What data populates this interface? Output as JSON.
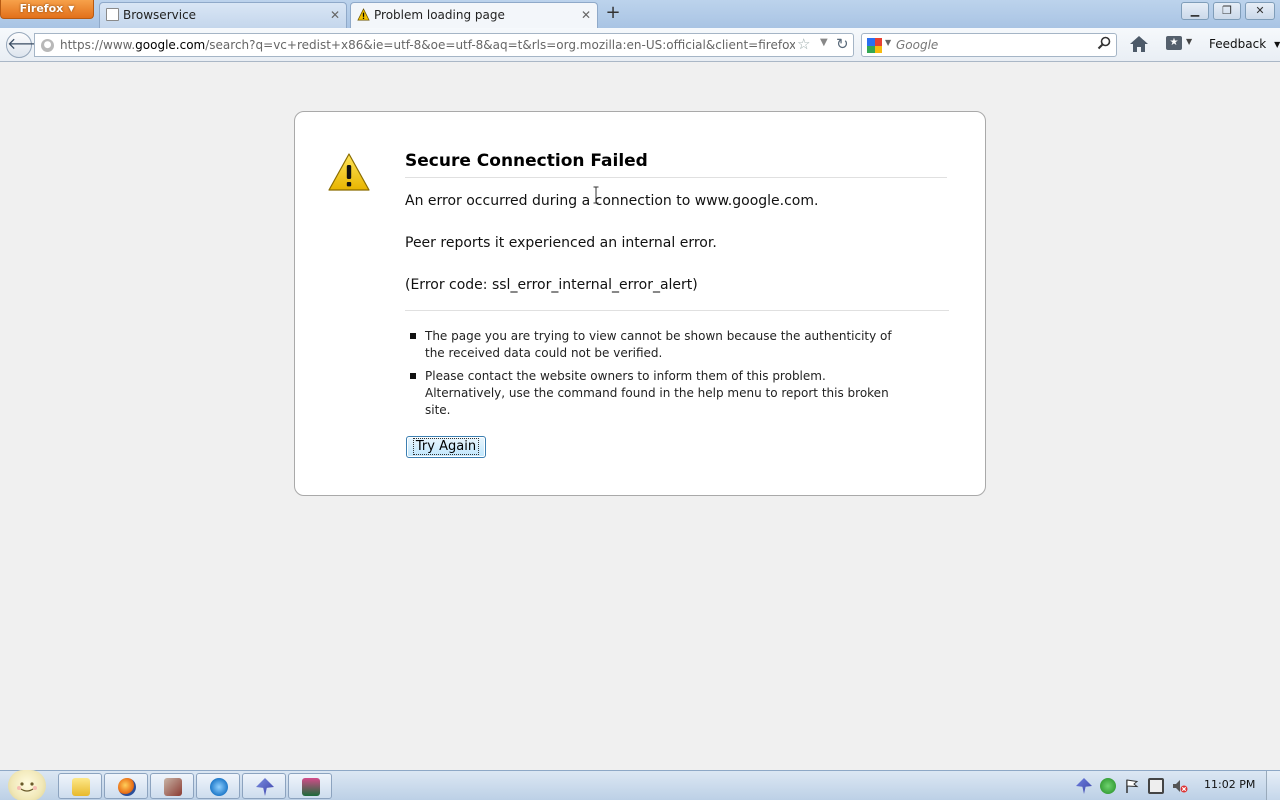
{
  "window": {
    "menu_button_label": "Firefox",
    "minimize_label": "▁",
    "restore_label": "❐",
    "close_label": "✕"
  },
  "tabs": [
    {
      "title": "Browservice",
      "favicon": "blank-page-icon",
      "active": false
    },
    {
      "title": "Problem loading page",
      "favicon": "warning-icon",
      "active": true
    }
  ],
  "navigation": {
    "url": "https://www.google.com/search?q=vc+redist+x86&ie=utf-8&oe=utf-8&aq=t&rls=org.mozilla:en-US:official&client=firefox-beta&channe",
    "url_prefix": "https://www.",
    "url_domain": "google.com",
    "url_rest": "/search?q=vc+redist+x86&ie=utf-8&oe=utf-8&aq=t&rls=org.mozilla:en-US:official&client=firefox-beta&channe",
    "search_placeholder": "Google",
    "search_engine": "Google",
    "feedback_label": "Feedback"
  },
  "error_page": {
    "title": "Secure Connection Failed",
    "line1": "An error occurred during a connection to www.google.com.",
    "line2": "Peer reports it experienced an internal error.",
    "line3": "(Error code: ssl_error_internal_error_alert)",
    "bullets": [
      "The page you are trying to view cannot be shown because the authenticity of the received data could not be verified.",
      "Please contact the website owners to inform them of this problem. Alternatively, use the command found in the help menu to report this broken site."
    ],
    "try_again_label": "Try Again"
  },
  "taskbar": {
    "apps": [
      "explorer-icon",
      "firefox-icon",
      "media-player-icon",
      "internet-explorer-icon",
      "app-icon",
      "app-icon"
    ],
    "clock": "11:02 PM"
  },
  "colors": {
    "firefox_button": "#e2701a",
    "titlebar": "#a9c4e4",
    "page_background": "#f0f0f0",
    "try_again_border": "#3c7fb1"
  }
}
